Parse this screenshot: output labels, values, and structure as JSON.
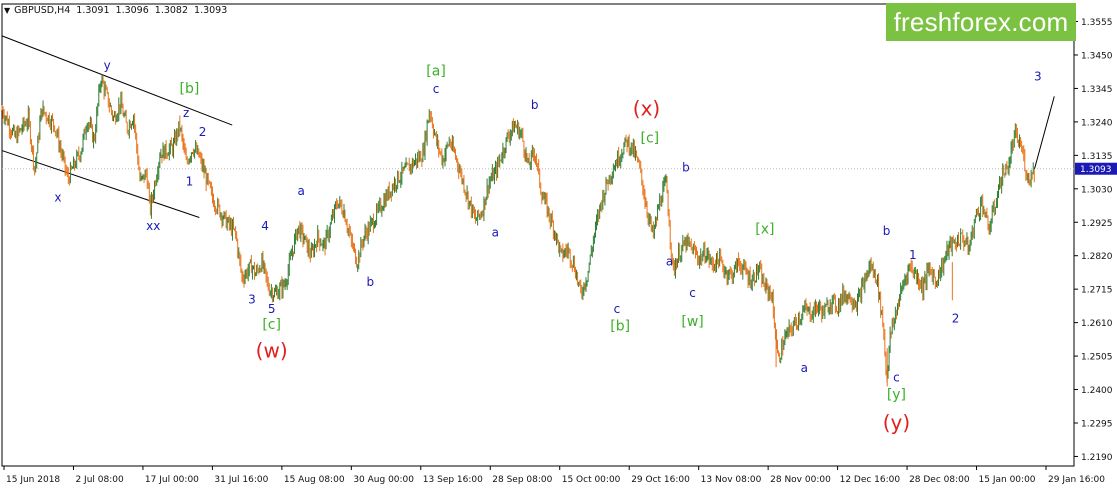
{
  "header": {
    "symbol": "GBPUSD,H4",
    "open": "1.3091",
    "high": "1.3096",
    "low": "1.3082",
    "close": "1.3093"
  },
  "brand": {
    "text": "freshforex.com",
    "color": "#7cc242"
  },
  "colors": {
    "candle_up": "#2e7d32",
    "candle_down": "#e8731a",
    "blue_label": "#1a1ab5",
    "green_label": "#3cb029",
    "red_label": "#e02020",
    "price_tag": "#1a1ab5"
  },
  "chart_data": {
    "type": "line",
    "instrument": "GBPUSD",
    "timeframe": "H4",
    "ylim": [
      1.216,
      1.361
    ],
    "y_ticks": [
      "1.3555",
      "1.3450",
      "1.3345",
      "1.3240",
      "1.3135",
      "1.3030",
      "1.2925",
      "1.2820",
      "1.2715",
      "1.2610",
      "1.2505",
      "1.2400",
      "1.2295",
      "1.2190"
    ],
    "x_ticks": [
      "15 Jun 2018",
      "2 Jul 08:00",
      "17 Jul 00:00",
      "31 Jul 16:00",
      "15 Aug 08:00",
      "30 Aug 00:00",
      "13 Sep 16:00",
      "28 Sep 08:00",
      "15 Oct 00:00",
      "29 Oct 16:00",
      "13 Nov 08:00",
      "28 Nov 00:00",
      "12 Dec 16:00",
      "28 Dec 08:00",
      "15 Jan 00:00",
      "29 Jan 16:00"
    ],
    "current_price": "1.3093",
    "series": [
      {
        "points": [
          [
            0.0,
            1.328
          ],
          [
            2.0,
            1.319
          ],
          [
            4.0,
            1.325
          ],
          [
            5.0,
            1.309
          ],
          [
            6.0,
            1.328
          ],
          [
            8.0,
            1.323
          ],
          [
            10.0,
            1.306
          ],
          [
            12.0,
            1.315
          ],
          [
            13.0,
            1.325
          ],
          [
            14.0,
            1.318
          ],
          [
            15.0,
            1.338
          ],
          [
            17.0,
            1.325
          ],
          [
            18.0,
            1.33
          ],
          [
            19.0,
            1.322
          ],
          [
            20.0,
            1.326
          ],
          [
            21.0,
            1.305
          ],
          [
            22.0,
            1.308
          ],
          [
            22.5,
            1.296
          ],
          [
            24.0,
            1.314
          ],
          [
            26.0,
            1.316
          ],
          [
            27.0,
            1.323
          ],
          [
            28.0,
            1.311
          ],
          [
            29.0,
            1.316
          ],
          [
            30.0,
            1.313
          ],
          [
            32.0,
            1.3
          ],
          [
            34.0,
            1.293
          ],
          [
            35.5,
            1.289
          ],
          [
            36.5,
            1.275
          ],
          [
            38.0,
            1.279
          ],
          [
            38.5,
            1.276
          ],
          [
            39.5,
            1.28
          ],
          [
            40.5,
            1.272
          ],
          [
            41.5,
            1.27
          ],
          [
            43.0,
            1.273
          ],
          [
            44.0,
            1.282
          ],
          [
            45.0,
            1.291
          ],
          [
            46.0,
            1.287
          ],
          [
            47.0,
            1.282
          ],
          [
            48.0,
            1.288
          ],
          [
            49.0,
            1.285
          ],
          [
            50.0,
            1.292
          ],
          [
            51.0,
            1.299
          ],
          [
            52.0,
            1.296
          ],
          [
            53.0,
            1.287
          ],
          [
            54.0,
            1.28
          ],
          [
            55.0,
            1.288
          ],
          [
            56.5,
            1.293
          ],
          [
            58.0,
            1.299
          ],
          [
            60.0,
            1.306
          ],
          [
            62.0,
            1.31
          ],
          [
            63.0,
            1.312
          ],
          [
            64.0,
            1.314
          ],
          [
            65.0,
            1.328
          ],
          [
            66.0,
            1.318
          ],
          [
            67.0,
            1.312
          ],
          [
            68.0,
            1.318
          ],
          [
            69.0,
            1.313
          ],
          [
            70.0,
            1.306
          ],
          [
            71.0,
            1.299
          ],
          [
            72.0,
            1.293
          ],
          [
            73.0,
            1.296
          ],
          [
            74.0,
            1.305
          ],
          [
            75.0,
            1.308
          ],
          [
            76.0,
            1.314
          ],
          [
            77.0,
            1.32
          ],
          [
            78.0,
            1.323
          ],
          [
            79.0,
            1.32
          ],
          [
            80.0,
            1.31
          ],
          [
            81.0,
            1.315
          ],
          [
            82.0,
            1.302
          ],
          [
            83.0,
            1.296
          ],
          [
            84.0,
            1.29
          ],
          [
            85.0,
            1.282
          ],
          [
            86.0,
            1.284
          ],
          [
            87.0,
            1.279
          ],
          [
            88.0,
            1.27
          ],
          [
            89.0,
            1.276
          ],
          [
            90.0,
            1.288
          ],
          [
            91.0,
            1.298
          ],
          [
            92.0,
            1.305
          ],
          [
            93.0,
            1.31
          ],
          [
            94.0,
            1.314
          ],
          [
            95.0,
            1.318
          ],
          [
            96.0,
            1.315
          ],
          [
            97.0,
            1.309
          ],
          [
            98.0,
            1.297
          ],
          [
            99.0,
            1.288
          ],
          [
            100.0,
            1.299
          ],
          [
            101.0,
            1.305
          ],
          [
            102.0,
            1.277
          ],
          [
            103.0,
            1.283
          ],
          [
            104.0,
            1.286
          ],
          [
            105.0,
            1.284
          ],
          [
            106.0,
            1.281
          ],
          [
            107.0,
            1.283
          ],
          [
            108.0,
            1.279
          ],
          [
            109.0,
            1.281
          ],
          [
            110.0,
            1.277
          ],
          [
            111.0,
            1.276
          ],
          [
            112.0,
            1.28
          ],
          [
            113.0,
            1.277
          ],
          [
            114.0,
            1.274
          ],
          [
            115.0,
            1.278
          ],
          [
            116.0,
            1.272
          ],
          [
            117.0,
            1.27
          ],
          [
            117.5,
            1.26
          ],
          [
            118.0,
            1.249
          ],
          [
            119.0,
            1.256
          ],
          [
            120.0,
            1.259
          ],
          [
            121.0,
            1.262
          ],
          [
            122.0,
            1.265
          ],
          [
            123.0,
            1.264
          ],
          [
            124.0,
            1.266
          ],
          [
            125.0,
            1.264
          ],
          [
            126.0,
            1.268
          ],
          [
            127.0,
            1.266
          ],
          [
            128.0,
            1.27
          ],
          [
            129.0,
            1.269
          ],
          [
            130.0,
            1.267
          ],
          [
            131.0,
            1.273
          ],
          [
            132.0,
            1.279
          ],
          [
            133.0,
            1.275
          ],
          [
            134.0,
            1.26
          ],
          [
            134.5,
            1.243
          ],
          [
            135.0,
            1.256
          ],
          [
            136.0,
            1.265
          ],
          [
            137.0,
            1.273
          ],
          [
            138.0,
            1.279
          ],
          [
            139.0,
            1.276
          ],
          [
            140.0,
            1.272
          ],
          [
            141.0,
            1.278
          ],
          [
            142.0,
            1.274
          ],
          [
            143.0,
            1.279
          ],
          [
            144.0,
            1.285
          ],
          [
            145.0,
            1.286
          ],
          [
            146.0,
            1.288
          ],
          [
            147.0,
            1.284
          ],
          [
            148.0,
            1.294
          ],
          [
            149.0,
            1.299
          ],
          [
            150.0,
            1.29
          ],
          [
            151.0,
            1.298
          ],
          [
            152.0,
            1.307
          ],
          [
            153.0,
            1.31
          ],
          [
            154.0,
            1.32
          ],
          [
            155.0,
            1.316
          ],
          [
            156.0,
            1.306
          ],
          [
            157.0,
            1.3093
          ]
        ]
      }
    ],
    "projection": [
      [
        157.0,
        1.3093
      ],
      [
        160.0,
        1.332
      ]
    ],
    "channel_lines": [
      {
        "from": [
          0.0,
          1.351
        ],
        "to": [
          35.0,
          1.323
        ]
      },
      {
        "from": [
          0.0,
          1.315
        ],
        "to": [
          30.0,
          1.294
        ]
      }
    ],
    "wave_labels": [
      {
        "text": "y",
        "x": 16.0,
        "y": 1.3405,
        "color": "blue"
      },
      {
        "text": "x",
        "x": 8.5,
        "y": 1.299,
        "color": "blue"
      },
      {
        "text": "xx",
        "x": 23.0,
        "y": 1.29,
        "color": "blue"
      },
      {
        "text": "z",
        "x": 28.0,
        "y": 1.3255,
        "color": "blue"
      },
      {
        "text": "[b]",
        "x": 28.5,
        "y": 1.333,
        "color": "green"
      },
      {
        "text": "2",
        "x": 30.5,
        "y": 1.3195,
        "color": "blue"
      },
      {
        "text": "1",
        "x": 28.5,
        "y": 1.304,
        "color": "blue"
      },
      {
        "text": "4",
        "x": 40.0,
        "y": 1.29,
        "color": "blue"
      },
      {
        "text": "3",
        "x": 38.0,
        "y": 1.267,
        "color": "blue"
      },
      {
        "text": "5",
        "x": 41.0,
        "y": 1.264,
        "color": "blue"
      },
      {
        "text": "[c]",
        "x": 41.0,
        "y": 1.259,
        "color": "green"
      },
      {
        "text": "(w)",
        "x": 41.0,
        "y": 1.25,
        "color": "red"
      },
      {
        "text": "a",
        "x": 45.5,
        "y": 1.301,
        "color": "blue"
      },
      {
        "text": "b",
        "x": 56.0,
        "y": 1.2725,
        "color": "blue"
      },
      {
        "text": "[a]",
        "x": 66.0,
        "y": 1.3385,
        "color": "green"
      },
      {
        "text": "c",
        "x": 66.0,
        "y": 1.333,
        "color": "blue"
      },
      {
        "text": "a",
        "x": 75.0,
        "y": 1.288,
        "color": "blue"
      },
      {
        "text": "b",
        "x": 81.0,
        "y": 1.328,
        "color": "blue"
      },
      {
        "text": "(x)",
        "x": 98.0,
        "y": 1.326,
        "color": "red"
      },
      {
        "text": "[c]",
        "x": 98.5,
        "y": 1.3175,
        "color": "green"
      },
      {
        "text": "b",
        "x": 104.0,
        "y": 1.3085,
        "color": "blue"
      },
      {
        "text": "a",
        "x": 101.5,
        "y": 1.279,
        "color": "blue"
      },
      {
        "text": "c",
        "x": 105.0,
        "y": 1.269,
        "color": "blue"
      },
      {
        "text": "c",
        "x": 93.5,
        "y": 1.264,
        "color": "blue"
      },
      {
        "text": "[b]",
        "x": 94.0,
        "y": 1.2585,
        "color": "green"
      },
      {
        "text": "[w]",
        "x": 105.0,
        "y": 1.26,
        "color": "green"
      },
      {
        "text": "[x]",
        "x": 116.0,
        "y": 1.289,
        "color": "green"
      },
      {
        "text": "a",
        "x": 122.0,
        "y": 1.2455,
        "color": "blue"
      },
      {
        "text": "b",
        "x": 134.5,
        "y": 1.2885,
        "color": "blue"
      },
      {
        "text": "c",
        "x": 136.0,
        "y": 1.2425,
        "color": "blue"
      },
      {
        "text": "[y]",
        "x": 136.0,
        "y": 1.237,
        "color": "green"
      },
      {
        "text": "(y)",
        "x": 136.0,
        "y": 1.2275,
        "color": "red"
      },
      {
        "text": "1",
        "x": 138.5,
        "y": 1.281,
        "color": "blue"
      },
      {
        "text": "2",
        "x": 145.0,
        "y": 1.261,
        "color": "blue"
      },
      {
        "text": "3",
        "x": 157.5,
        "y": 1.337,
        "color": "white"
      }
    ]
  }
}
